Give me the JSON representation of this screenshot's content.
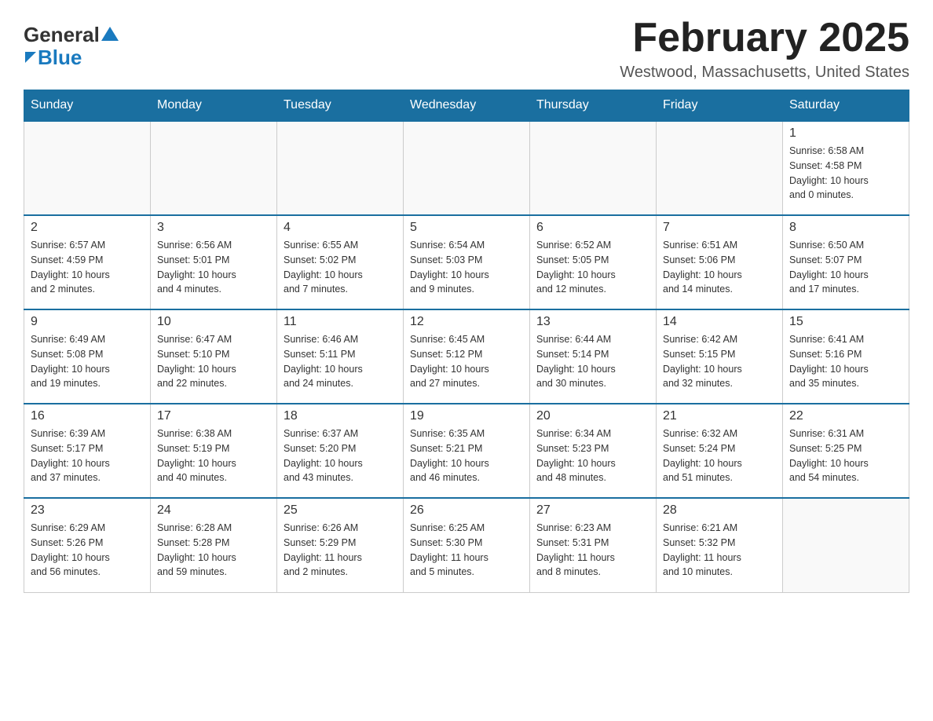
{
  "header": {
    "logo": {
      "general": "General",
      "blue": "Blue"
    },
    "title": "February 2025",
    "subtitle": "Westwood, Massachusetts, United States"
  },
  "weekdays": [
    "Sunday",
    "Monday",
    "Tuesday",
    "Wednesday",
    "Thursday",
    "Friday",
    "Saturday"
  ],
  "weeks": [
    [
      {
        "day": "",
        "info": ""
      },
      {
        "day": "",
        "info": ""
      },
      {
        "day": "",
        "info": ""
      },
      {
        "day": "",
        "info": ""
      },
      {
        "day": "",
        "info": ""
      },
      {
        "day": "",
        "info": ""
      },
      {
        "day": "1",
        "info": "Sunrise: 6:58 AM\nSunset: 4:58 PM\nDaylight: 10 hours\nand 0 minutes."
      }
    ],
    [
      {
        "day": "2",
        "info": "Sunrise: 6:57 AM\nSunset: 4:59 PM\nDaylight: 10 hours\nand 2 minutes."
      },
      {
        "day": "3",
        "info": "Sunrise: 6:56 AM\nSunset: 5:01 PM\nDaylight: 10 hours\nand 4 minutes."
      },
      {
        "day": "4",
        "info": "Sunrise: 6:55 AM\nSunset: 5:02 PM\nDaylight: 10 hours\nand 7 minutes."
      },
      {
        "day": "5",
        "info": "Sunrise: 6:54 AM\nSunset: 5:03 PM\nDaylight: 10 hours\nand 9 minutes."
      },
      {
        "day": "6",
        "info": "Sunrise: 6:52 AM\nSunset: 5:05 PM\nDaylight: 10 hours\nand 12 minutes."
      },
      {
        "day": "7",
        "info": "Sunrise: 6:51 AM\nSunset: 5:06 PM\nDaylight: 10 hours\nand 14 minutes."
      },
      {
        "day": "8",
        "info": "Sunrise: 6:50 AM\nSunset: 5:07 PM\nDaylight: 10 hours\nand 17 minutes."
      }
    ],
    [
      {
        "day": "9",
        "info": "Sunrise: 6:49 AM\nSunset: 5:08 PM\nDaylight: 10 hours\nand 19 minutes."
      },
      {
        "day": "10",
        "info": "Sunrise: 6:47 AM\nSunset: 5:10 PM\nDaylight: 10 hours\nand 22 minutes."
      },
      {
        "day": "11",
        "info": "Sunrise: 6:46 AM\nSunset: 5:11 PM\nDaylight: 10 hours\nand 24 minutes."
      },
      {
        "day": "12",
        "info": "Sunrise: 6:45 AM\nSunset: 5:12 PM\nDaylight: 10 hours\nand 27 minutes."
      },
      {
        "day": "13",
        "info": "Sunrise: 6:44 AM\nSunset: 5:14 PM\nDaylight: 10 hours\nand 30 minutes."
      },
      {
        "day": "14",
        "info": "Sunrise: 6:42 AM\nSunset: 5:15 PM\nDaylight: 10 hours\nand 32 minutes."
      },
      {
        "day": "15",
        "info": "Sunrise: 6:41 AM\nSunset: 5:16 PM\nDaylight: 10 hours\nand 35 minutes."
      }
    ],
    [
      {
        "day": "16",
        "info": "Sunrise: 6:39 AM\nSunset: 5:17 PM\nDaylight: 10 hours\nand 37 minutes."
      },
      {
        "day": "17",
        "info": "Sunrise: 6:38 AM\nSunset: 5:19 PM\nDaylight: 10 hours\nand 40 minutes."
      },
      {
        "day": "18",
        "info": "Sunrise: 6:37 AM\nSunset: 5:20 PM\nDaylight: 10 hours\nand 43 minutes."
      },
      {
        "day": "19",
        "info": "Sunrise: 6:35 AM\nSunset: 5:21 PM\nDaylight: 10 hours\nand 46 minutes."
      },
      {
        "day": "20",
        "info": "Sunrise: 6:34 AM\nSunset: 5:23 PM\nDaylight: 10 hours\nand 48 minutes."
      },
      {
        "day": "21",
        "info": "Sunrise: 6:32 AM\nSunset: 5:24 PM\nDaylight: 10 hours\nand 51 minutes."
      },
      {
        "day": "22",
        "info": "Sunrise: 6:31 AM\nSunset: 5:25 PM\nDaylight: 10 hours\nand 54 minutes."
      }
    ],
    [
      {
        "day": "23",
        "info": "Sunrise: 6:29 AM\nSunset: 5:26 PM\nDaylight: 10 hours\nand 56 minutes."
      },
      {
        "day": "24",
        "info": "Sunrise: 6:28 AM\nSunset: 5:28 PM\nDaylight: 10 hours\nand 59 minutes."
      },
      {
        "day": "25",
        "info": "Sunrise: 6:26 AM\nSunset: 5:29 PM\nDaylight: 11 hours\nand 2 minutes."
      },
      {
        "day": "26",
        "info": "Sunrise: 6:25 AM\nSunset: 5:30 PM\nDaylight: 11 hours\nand 5 minutes."
      },
      {
        "day": "27",
        "info": "Sunrise: 6:23 AM\nSunset: 5:31 PM\nDaylight: 11 hours\nand 8 minutes."
      },
      {
        "day": "28",
        "info": "Sunrise: 6:21 AM\nSunset: 5:32 PM\nDaylight: 11 hours\nand 10 minutes."
      },
      {
        "day": "",
        "info": ""
      }
    ]
  ]
}
